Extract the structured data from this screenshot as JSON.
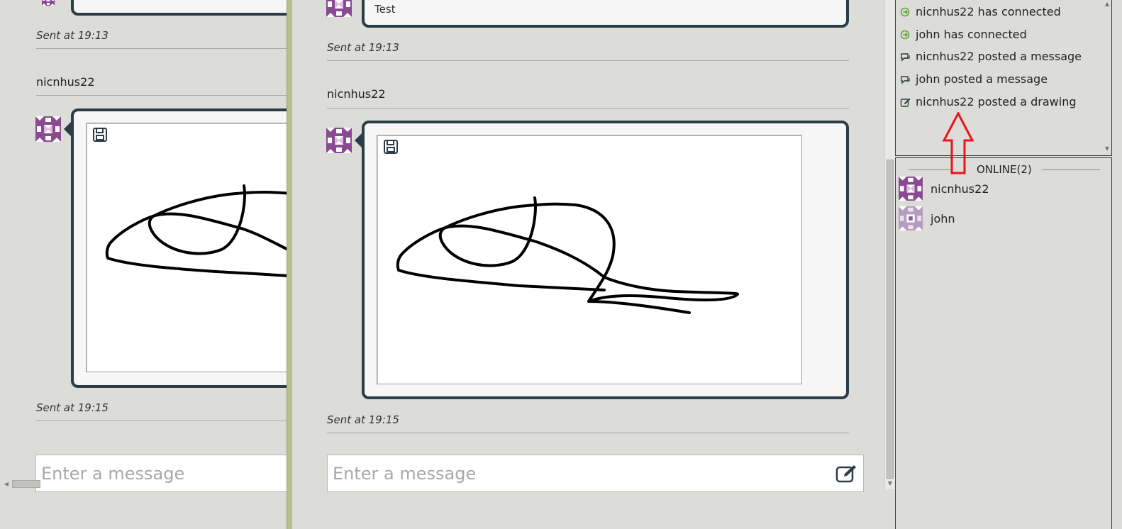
{
  "left_window": {
    "sent_top": "Sent at 19:13",
    "username": "nicnhus22",
    "sent_bottom": "Sent at 19:15",
    "input_placeholder": "Enter a message"
  },
  "main_window": {
    "prev_message_text": "Test",
    "sent_top": "Sent at 19:13",
    "username": "nicnhus22",
    "sent_bottom": "Sent at 19:15",
    "input_placeholder": "Enter a message"
  },
  "events": [
    {
      "icon": "connect-icon",
      "text": "nicnhus22 has connected"
    },
    {
      "icon": "connect-icon",
      "text": "john has connected"
    },
    {
      "icon": "chat-bubbles-icon",
      "text": "nicnhus22 posted a message"
    },
    {
      "icon": "chat-bubbles-icon",
      "text": "john posted a message"
    },
    {
      "icon": "edit-icon",
      "text": "nicnhus22 posted a drawing"
    }
  ],
  "online": {
    "header": "ONLINE(2)",
    "users": [
      "nicnhus22",
      "john"
    ]
  },
  "colors": {
    "background": "#dcdcd8",
    "bubble_border": "#2b3e48",
    "connect_green": "#5aa832",
    "annotation_red": "#e8141e",
    "avatar_purple": "#8a4a92"
  }
}
